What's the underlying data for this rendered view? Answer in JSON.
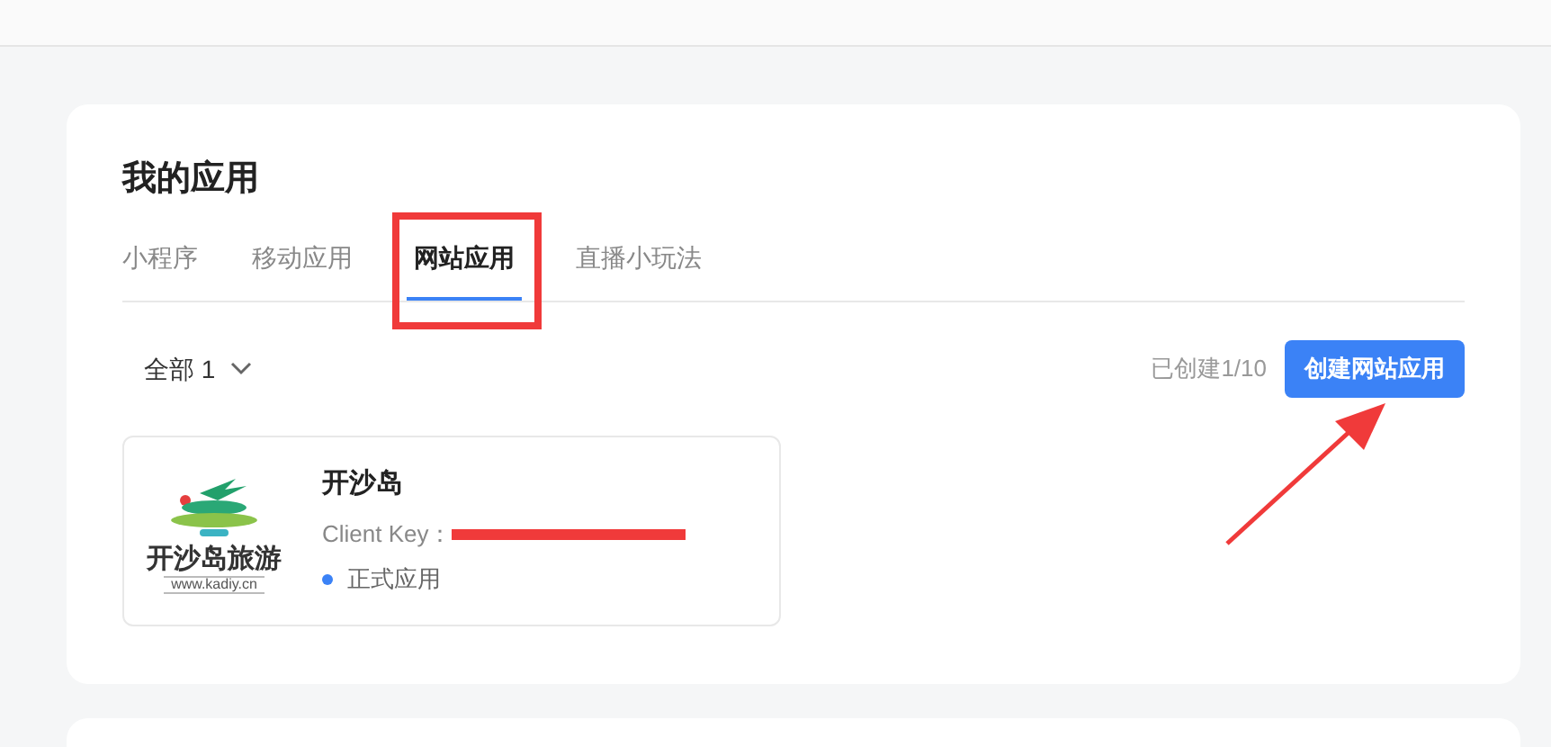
{
  "page_title": "我的应用",
  "tabs": [
    {
      "label": "小程序",
      "selected": false
    },
    {
      "label": "移动应用",
      "selected": false
    },
    {
      "label": "网站应用",
      "selected": true
    },
    {
      "label": "直播小玩法",
      "selected": false
    }
  ],
  "filter": {
    "label": "全部 1"
  },
  "quota": "已创建1/10",
  "create_button": "创建网站应用",
  "apps": [
    {
      "logo_text": "开沙岛旅游",
      "logo_url": "www.kadiy.cn",
      "name": "开沙岛",
      "key_label": "Client Key：",
      "status": "正式应用",
      "color": "#3b82f6"
    }
  ]
}
